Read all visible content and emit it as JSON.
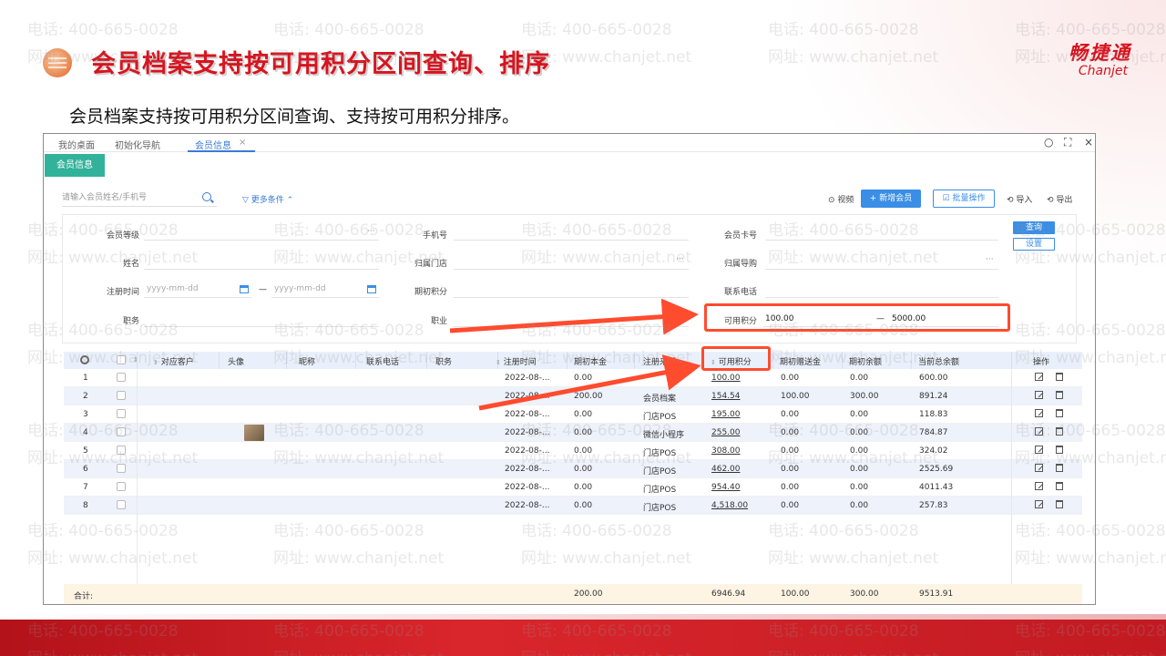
{
  "slide": {
    "title": "会员档案支持按可用积分区间查询、排序",
    "subtitle": "会员档案支持按可用积分区间查询、支持按可用积分排序。",
    "logo_cn": "畅捷通",
    "logo_en": "Chanjet",
    "watermark_phone": "电话: 400-665-0028",
    "watermark_web": "网址: www.chanjet.net"
  },
  "app": {
    "tabs": [
      "我的桌面",
      "初始化导航",
      "会员信息"
    ],
    "tab_close": "×",
    "module_tab": "会员信息",
    "window_controls": {
      "search": "○",
      "max": "⛶",
      "close": "×"
    },
    "search_placeholder": "请输入会员姓名/手机号",
    "more_conditions": "▽ 更多条件 ⌃",
    "toolbar": {
      "video": "⊙ 视频",
      "add_member": "+ 新增会员",
      "batch": "☑ 批量操作",
      "import": "⟲ 导入",
      "export": "⟲ 导出"
    },
    "filters": {
      "member_level": "会员等级",
      "phone": "手机号",
      "member_card": "会员卡号",
      "name": "姓名",
      "store": "归属门店",
      "guide": "归属导购",
      "reg_time": "注册时间",
      "date_placeholder": "yyyy-mm-dd",
      "dash": "—",
      "init_points": "期初积分",
      "contact_phone": "联系电话",
      "position": "职务",
      "occupation": "职业",
      "avail_points": "可用积分",
      "points_min": "100.00",
      "points_max": "5000.00",
      "dots": "···"
    },
    "query_btn": "查询",
    "setting_btn": "设置",
    "table": {
      "headers": {
        "customer": "对应客户",
        "avatar": "头像",
        "nickname": "昵称",
        "contact": "联系电话",
        "position": "职务",
        "reg_time": "注册时间",
        "init_balance": "期初本金",
        "reg_source": "注册来源",
        "avail_points": "可用积分",
        "init_gift": "期初赠送金",
        "init_remain": "期初余额",
        "total_balance": "当前总余额",
        "actions": "操作"
      },
      "sort_glyph": "⇕",
      "rows": [
        {
          "no": "1",
          "reg": "2022-08-...",
          "init": "0.00",
          "source": "",
          "points": "100.00",
          "gift": "0.00",
          "remain": "0.00",
          "total": "600.00"
        },
        {
          "no": "2",
          "reg": "2022-08-...",
          "init": "200.00",
          "source": "会员档案",
          "points": "154.54",
          "gift": "100.00",
          "remain": "300.00",
          "total": "891.24"
        },
        {
          "no": "3",
          "reg": "2022-08-...",
          "init": "0.00",
          "source": "门店POS",
          "points": "195.00",
          "gift": "0.00",
          "remain": "0.00",
          "total": "118.83"
        },
        {
          "no": "4",
          "reg": "2022-08-...",
          "init": "0.00",
          "source": "微信小程序",
          "points": "255.00",
          "gift": "0.00",
          "remain": "0.00",
          "total": "784.87"
        },
        {
          "no": "5",
          "reg": "2022-08-...",
          "init": "0.00",
          "source": "门店POS",
          "points": "308.00",
          "gift": "0.00",
          "remain": "0.00",
          "total": "324.02"
        },
        {
          "no": "6",
          "reg": "2022-08-...",
          "init": "0.00",
          "source": "门店POS",
          "points": "462.00",
          "gift": "0.00",
          "remain": "0.00",
          "total": "2525.69"
        },
        {
          "no": "7",
          "reg": "2022-08-...",
          "init": "0.00",
          "source": "门店POS",
          "points": "954.40",
          "gift": "0.00",
          "remain": "0.00",
          "total": "4011.43"
        },
        {
          "no": "8",
          "reg": "2022-08-...",
          "init": "0.00",
          "source": "门店POS",
          "points": "4,518.00",
          "gift": "0.00",
          "remain": "0.00",
          "total": "257.83"
        }
      ],
      "footer": {
        "label": "合计:",
        "init": "200.00",
        "points": "6946.94",
        "gift": "100.00",
        "remain": "300.00",
        "total": "9513.91"
      }
    },
    "colors": {
      "accent": "#3a8ee6",
      "module": "#33b29b",
      "highlight": "#ff4b2e",
      "title": "#d7141f"
    }
  }
}
